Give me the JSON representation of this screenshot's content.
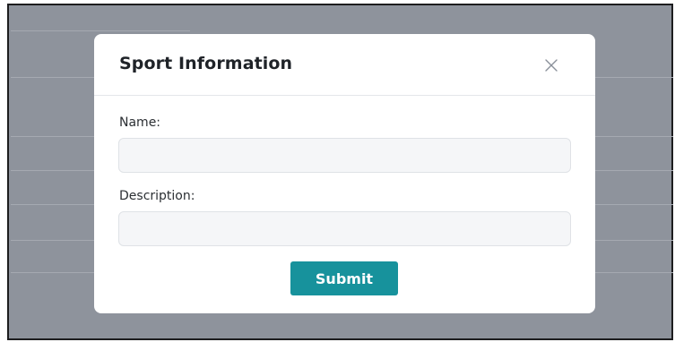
{
  "modal": {
    "title": "Sport Information",
    "close_icon": "close-icon",
    "fields": {
      "name": {
        "label": "Name:",
        "value": "",
        "placeholder": ""
      },
      "description": {
        "label": "Description:",
        "value": "",
        "placeholder": ""
      }
    },
    "submit_label": "Submit"
  },
  "colors": {
    "overlay": "#8e939c",
    "modal_background": "#ffffff",
    "input_background": "#f5f6f8",
    "submit_button": "#17929c",
    "submit_text": "#ffffff"
  }
}
